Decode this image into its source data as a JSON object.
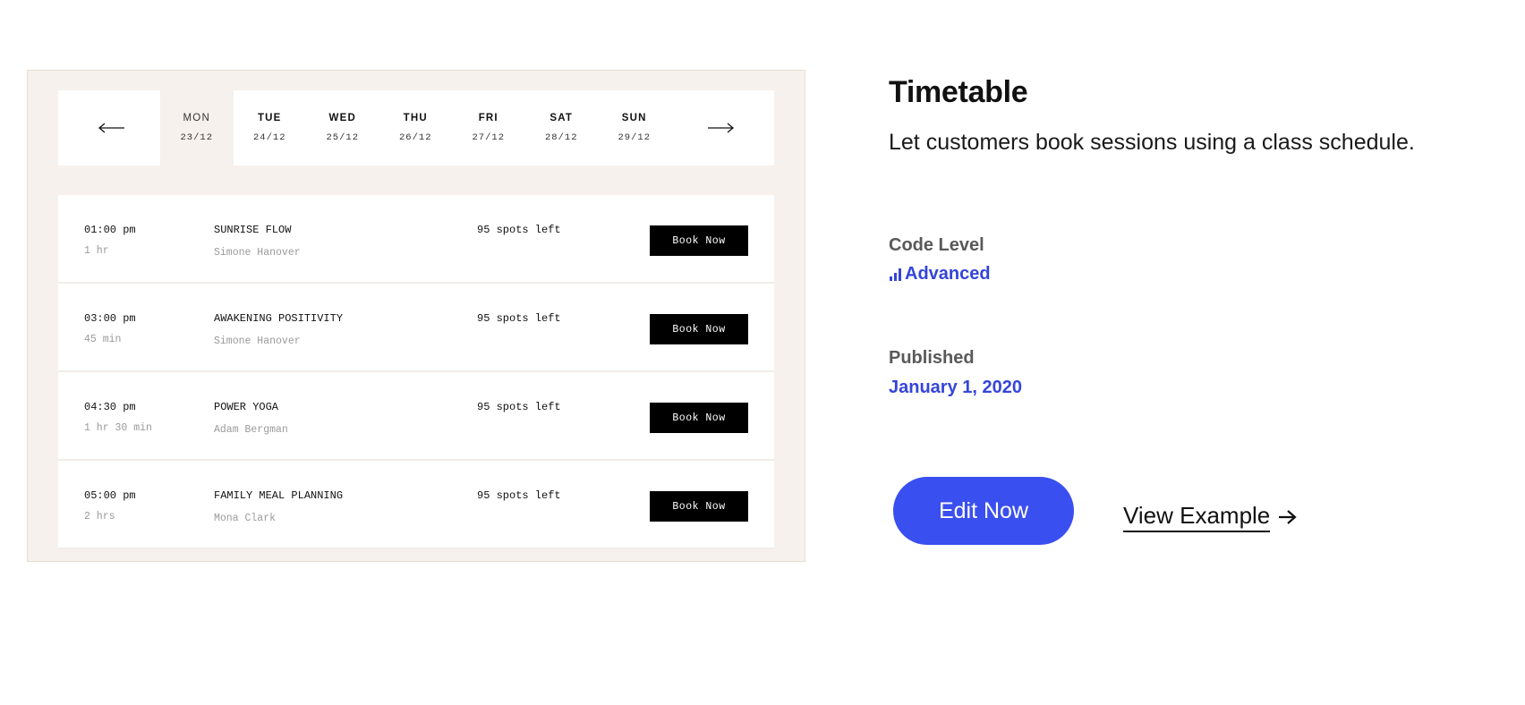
{
  "preview": {
    "days": [
      {
        "name": "MON",
        "date": "23/12",
        "active": true
      },
      {
        "name": "TUE",
        "date": "24/12",
        "active": false
      },
      {
        "name": "WED",
        "date": "25/12",
        "active": false
      },
      {
        "name": "THU",
        "date": "26/12",
        "active": false
      },
      {
        "name": "FRI",
        "date": "27/12",
        "active": false
      },
      {
        "name": "SAT",
        "date": "28/12",
        "active": false
      },
      {
        "name": "SUN",
        "date": "29/12",
        "active": false
      }
    ],
    "prev_icon": "arrow-left-icon",
    "next_icon": "arrow-right-icon",
    "sessions": [
      {
        "time": "01:00 pm",
        "duration": "1 hr",
        "title": "SUNRISE FLOW",
        "instructor": "Simone Hanover",
        "spots": "95 spots left",
        "button": "Book Now"
      },
      {
        "time": "03:00 pm",
        "duration": "45 min",
        "title": "AWAKENING POSITIVITY",
        "instructor": "Simone Hanover",
        "spots": "95 spots left",
        "button": "Book Now"
      },
      {
        "time": "04:30 pm",
        "duration": "1 hr 30 min",
        "title": "POWER YOGA",
        "instructor": "Adam Bergman",
        "spots": "95 spots left",
        "button": "Book Now"
      },
      {
        "time": "05:00 pm",
        "duration": "2 hrs",
        "title": "FAMILY MEAL PLANNING",
        "instructor": "Mona Clark",
        "spots": "95 spots left",
        "button": "Book Now"
      }
    ]
  },
  "info": {
    "title": "Timetable",
    "subtitle": "Let customers book sessions using a class schedule.",
    "code_level_label": "Code Level",
    "code_level_value": "Advanced",
    "code_level_icon": "signal-bars-icon",
    "published_label": "Published",
    "published_value": "January 1, 2020",
    "edit_button": "Edit Now",
    "view_link": "View Example",
    "view_link_icon": "arrow-right-icon"
  },
  "colors": {
    "accent": "#3a4ff0",
    "accent_text": "#3545d9",
    "preview_bg": "#f6f1ec",
    "book_button": "#000000"
  }
}
